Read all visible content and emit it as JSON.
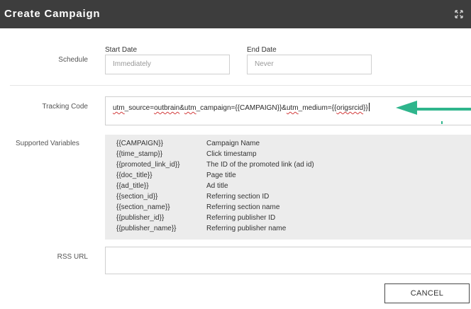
{
  "window": {
    "title": "Create Campaign",
    "expand_icon": "expand-icon"
  },
  "schedule": {
    "label": "Schedule",
    "start_date": {
      "label": "Start Date",
      "value": "Immediately"
    },
    "end_date": {
      "label": "End Date",
      "value": "Never"
    }
  },
  "tracking": {
    "label": "Tracking Code",
    "value_parts": [
      "utm",
      "_source=",
      "outbrain",
      "&",
      "utm",
      "_campaign={{CAMPAIGN}}&",
      "utm",
      "_medium={{",
      "origsrcid",
      "}}"
    ],
    "arrow_color": "#2fb58c"
  },
  "supported_variables": {
    "label": "Supported Variables",
    "rows": [
      {
        "name": "{{CAMPAIGN}}",
        "description": "Campaign Name"
      },
      {
        "name": "{{time_stamp}}",
        "description": "Click timestamp"
      },
      {
        "name": "{{promoted_link_id}}",
        "description": "The ID of the promoted link (ad id)"
      },
      {
        "name": "{{doc_title}}",
        "description": "Page title"
      },
      {
        "name": "{{ad_title}}",
        "description": "Ad title"
      },
      {
        "name": "{{section_id}}",
        "description": "Referring section ID"
      },
      {
        "name": "{{section_name}}",
        "description": "Referring section name"
      },
      {
        "name": "{{publisher_id}}",
        "description": "Referring publisher ID"
      },
      {
        "name": "{{publisher_name}}",
        "description": "Referring publisher name"
      }
    ]
  },
  "rss": {
    "label": "RSS URL",
    "value": ""
  },
  "buttons": {
    "cancel": "CANCEL"
  },
  "colors": {
    "titlebar": "#3d3d3d",
    "variables_bg": "#ececec",
    "spell_underline": "#d23b3b"
  }
}
